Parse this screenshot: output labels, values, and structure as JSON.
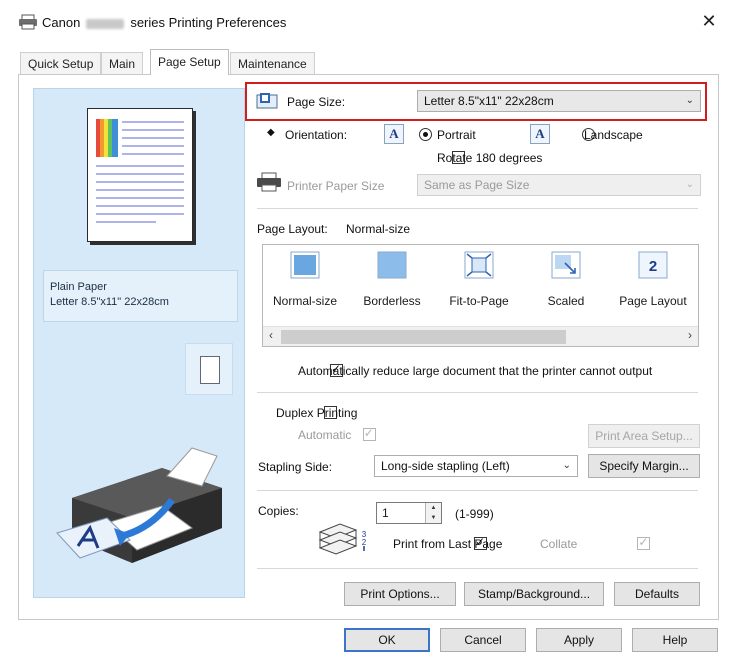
{
  "window": {
    "app_name": "Canon",
    "title_suffix": "series Printing Preferences",
    "close_glyph": "✕"
  },
  "tabs": [
    {
      "label": "Quick Setup",
      "active": false
    },
    {
      "label": "Main",
      "active": false
    },
    {
      "label": "Page Setup",
      "active": true
    },
    {
      "label": "Maintenance",
      "active": false
    }
  ],
  "preview": {
    "media_type": "Plain Paper",
    "paper_size": "Letter 8.5\"x11\" 22x28cm"
  },
  "page_size": {
    "label": "Page Size:",
    "value": "Letter 8.5\"x11\" 22x28cm",
    "highlight_color": "#d51c1c"
  },
  "orientation": {
    "label": "Orientation:",
    "portrait_label": "Portrait",
    "landscape_label": "Landscape",
    "selected": "Portrait",
    "rotate_label": "Rotate 180 degrees",
    "rotate_checked": false
  },
  "printer_paper_size": {
    "label": "Printer Paper Size",
    "value": "Same as Page Size",
    "enabled": false
  },
  "page_layout": {
    "label": "Page Layout:",
    "current": "Normal-size",
    "options": [
      {
        "label": "Normal-size",
        "icon": "normal-size-icon"
      },
      {
        "label": "Borderless",
        "icon": "borderless-icon"
      },
      {
        "label": "Fit-to-Page",
        "icon": "fit-to-page-icon"
      },
      {
        "label": "Scaled",
        "icon": "scaled-icon"
      },
      {
        "label": "Page Layout",
        "icon": "page-layout-icon",
        "badge": "2"
      }
    ]
  },
  "auto_reduce": {
    "label": "Automatically reduce large document that the printer cannot output",
    "checked": true
  },
  "duplex": {
    "label": "Duplex Printing",
    "checked": false,
    "automatic_label": "Automatic",
    "automatic_checked": true,
    "print_area_button": "Print Area Setup..."
  },
  "stapling": {
    "label": "Stapling Side:",
    "value": "Long-side stapling (Left)",
    "specify_margin_button": "Specify Margin..."
  },
  "copies": {
    "label": "Copies:",
    "value": "1",
    "range": "(1-999)",
    "print_from_last_label": "Print from Last Page",
    "print_from_last_checked": true,
    "collate_label": "Collate",
    "collate_checked": true
  },
  "bottom_buttons": {
    "print_options": "Print Options...",
    "stamp_background": "Stamp/Background...",
    "defaults": "Defaults"
  },
  "dialog_buttons": {
    "ok": "OK",
    "cancel": "Cancel",
    "apply": "Apply",
    "help": "Help"
  },
  "colors": {
    "preview_panel": "#d6e9f8",
    "default_button_border": "#3a76c8"
  }
}
